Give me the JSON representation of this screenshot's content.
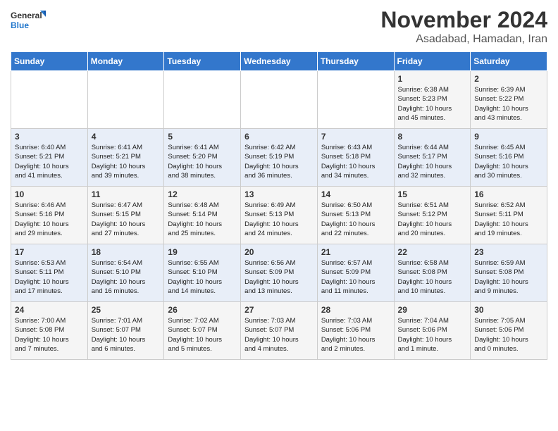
{
  "header": {
    "logo_line1": "General",
    "logo_line2": "Blue",
    "month": "November 2024",
    "location": "Asadabad, Hamadan, Iran"
  },
  "days_of_week": [
    "Sunday",
    "Monday",
    "Tuesday",
    "Wednesday",
    "Thursday",
    "Friday",
    "Saturday"
  ],
  "weeks": [
    [
      {
        "day": "",
        "info": ""
      },
      {
        "day": "",
        "info": ""
      },
      {
        "day": "",
        "info": ""
      },
      {
        "day": "",
        "info": ""
      },
      {
        "day": "",
        "info": ""
      },
      {
        "day": "1",
        "info": "Sunrise: 6:38 AM\nSunset: 5:23 PM\nDaylight: 10 hours\nand 45 minutes."
      },
      {
        "day": "2",
        "info": "Sunrise: 6:39 AM\nSunset: 5:22 PM\nDaylight: 10 hours\nand 43 minutes."
      }
    ],
    [
      {
        "day": "3",
        "info": "Sunrise: 6:40 AM\nSunset: 5:21 PM\nDaylight: 10 hours\nand 41 minutes."
      },
      {
        "day": "4",
        "info": "Sunrise: 6:41 AM\nSunset: 5:21 PM\nDaylight: 10 hours\nand 39 minutes."
      },
      {
        "day": "5",
        "info": "Sunrise: 6:41 AM\nSunset: 5:20 PM\nDaylight: 10 hours\nand 38 minutes."
      },
      {
        "day": "6",
        "info": "Sunrise: 6:42 AM\nSunset: 5:19 PM\nDaylight: 10 hours\nand 36 minutes."
      },
      {
        "day": "7",
        "info": "Sunrise: 6:43 AM\nSunset: 5:18 PM\nDaylight: 10 hours\nand 34 minutes."
      },
      {
        "day": "8",
        "info": "Sunrise: 6:44 AM\nSunset: 5:17 PM\nDaylight: 10 hours\nand 32 minutes."
      },
      {
        "day": "9",
        "info": "Sunrise: 6:45 AM\nSunset: 5:16 PM\nDaylight: 10 hours\nand 30 minutes."
      }
    ],
    [
      {
        "day": "10",
        "info": "Sunrise: 6:46 AM\nSunset: 5:16 PM\nDaylight: 10 hours\nand 29 minutes."
      },
      {
        "day": "11",
        "info": "Sunrise: 6:47 AM\nSunset: 5:15 PM\nDaylight: 10 hours\nand 27 minutes."
      },
      {
        "day": "12",
        "info": "Sunrise: 6:48 AM\nSunset: 5:14 PM\nDaylight: 10 hours\nand 25 minutes."
      },
      {
        "day": "13",
        "info": "Sunrise: 6:49 AM\nSunset: 5:13 PM\nDaylight: 10 hours\nand 24 minutes."
      },
      {
        "day": "14",
        "info": "Sunrise: 6:50 AM\nSunset: 5:13 PM\nDaylight: 10 hours\nand 22 minutes."
      },
      {
        "day": "15",
        "info": "Sunrise: 6:51 AM\nSunset: 5:12 PM\nDaylight: 10 hours\nand 20 minutes."
      },
      {
        "day": "16",
        "info": "Sunrise: 6:52 AM\nSunset: 5:11 PM\nDaylight: 10 hours\nand 19 minutes."
      }
    ],
    [
      {
        "day": "17",
        "info": "Sunrise: 6:53 AM\nSunset: 5:11 PM\nDaylight: 10 hours\nand 17 minutes."
      },
      {
        "day": "18",
        "info": "Sunrise: 6:54 AM\nSunset: 5:10 PM\nDaylight: 10 hours\nand 16 minutes."
      },
      {
        "day": "19",
        "info": "Sunrise: 6:55 AM\nSunset: 5:10 PM\nDaylight: 10 hours\nand 14 minutes."
      },
      {
        "day": "20",
        "info": "Sunrise: 6:56 AM\nSunset: 5:09 PM\nDaylight: 10 hours\nand 13 minutes."
      },
      {
        "day": "21",
        "info": "Sunrise: 6:57 AM\nSunset: 5:09 PM\nDaylight: 10 hours\nand 11 minutes."
      },
      {
        "day": "22",
        "info": "Sunrise: 6:58 AM\nSunset: 5:08 PM\nDaylight: 10 hours\nand 10 minutes."
      },
      {
        "day": "23",
        "info": "Sunrise: 6:59 AM\nSunset: 5:08 PM\nDaylight: 10 hours\nand 9 minutes."
      }
    ],
    [
      {
        "day": "24",
        "info": "Sunrise: 7:00 AM\nSunset: 5:08 PM\nDaylight: 10 hours\nand 7 minutes."
      },
      {
        "day": "25",
        "info": "Sunrise: 7:01 AM\nSunset: 5:07 PM\nDaylight: 10 hours\nand 6 minutes."
      },
      {
        "day": "26",
        "info": "Sunrise: 7:02 AM\nSunset: 5:07 PM\nDaylight: 10 hours\nand 5 minutes."
      },
      {
        "day": "27",
        "info": "Sunrise: 7:03 AM\nSunset: 5:07 PM\nDaylight: 10 hours\nand 4 minutes."
      },
      {
        "day": "28",
        "info": "Sunrise: 7:03 AM\nSunset: 5:06 PM\nDaylight: 10 hours\nand 2 minutes."
      },
      {
        "day": "29",
        "info": "Sunrise: 7:04 AM\nSunset: 5:06 PM\nDaylight: 10 hours\nand 1 minute."
      },
      {
        "day": "30",
        "info": "Sunrise: 7:05 AM\nSunset: 5:06 PM\nDaylight: 10 hours\nand 0 minutes."
      }
    ]
  ]
}
